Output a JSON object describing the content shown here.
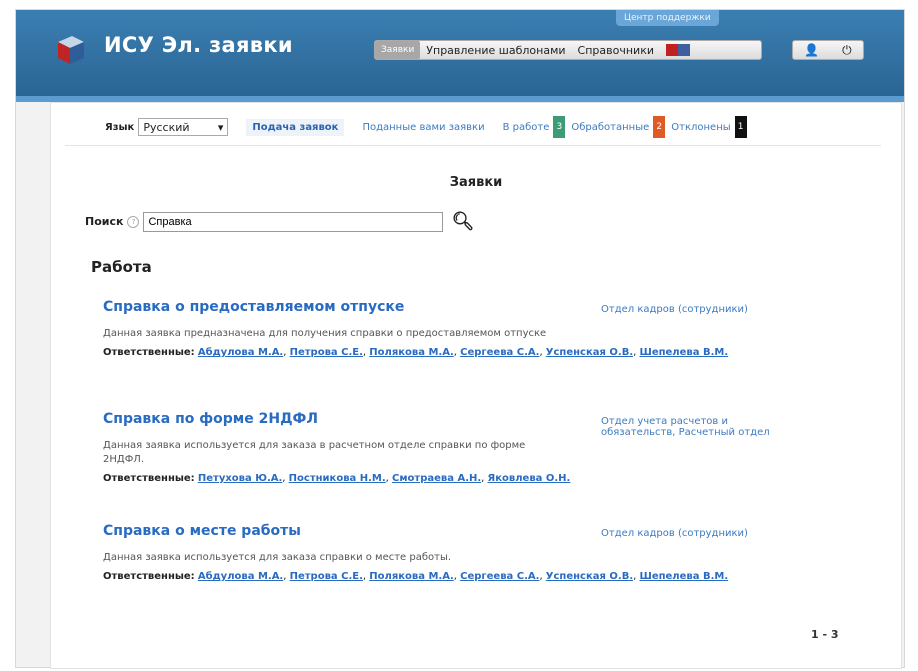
{
  "header": {
    "title": "ИСУ Эл. заявки",
    "tooltip": "Центр поддержки",
    "nav": [
      {
        "label": "Заявки",
        "active": true
      },
      {
        "label": "Управление шаблонами",
        "active": false
      },
      {
        "label": "Справочники",
        "active": false
      }
    ]
  },
  "subbar": {
    "lang_label": "Язык",
    "lang_value": "Русский",
    "links": [
      {
        "label": "Подача заявок",
        "active": true
      },
      {
        "label": "Поданные вами заявки",
        "active": false
      }
    ],
    "in_work_label": "В работе",
    "in_work_count": "3",
    "processed_label": "Обработанные",
    "processed_count": "2",
    "rejected_label": "Отклонены",
    "rejected_count": "1"
  },
  "page_title": "Заявки",
  "search": {
    "label": "Поиск",
    "value": "Справка"
  },
  "section_title": "Работа",
  "items": [
    {
      "title": "Справка о предоставляемом отпуске",
      "dept": "Отдел кадров (сотрудники)",
      "desc": "Данная заявка предназначена для получения справки о предоставляемом отпуске",
      "resp_label": "Ответственные:",
      "resp": [
        "Абдулова М.А.",
        "Петрова С.Е.",
        "Полякова М.А.",
        "Сергеева С.А.",
        "Успенская О.В.",
        "Шепелева В.М."
      ]
    },
    {
      "title": "Справка по форме 2НДФЛ",
      "dept": "Отдел учета расчетов и обязательств, Расчетный отдел",
      "desc": "Данная заявка используется для заказа в расчетном отделе справки по форме 2НДФЛ.",
      "resp_label": "Ответственные:",
      "resp": [
        "Петухова Ю.А.",
        "Постникова Н.М.",
        "Смотраева А.Н.",
        "Яковлева О.Н."
      ]
    },
    {
      "title": "Справка о месте работы",
      "dept": "Отдел кадров (сотрудники)",
      "desc": "Данная заявка используется для заказа справки о месте работы.",
      "resp_label": "Ответственные:",
      "resp": [
        "Абдулова М.А.",
        "Петрова С.Е.",
        "Полякова М.А.",
        "Сергеева С.А.",
        "Успенская О.В.",
        "Шепелева В.М."
      ]
    }
  ],
  "pager": "1 - 3"
}
